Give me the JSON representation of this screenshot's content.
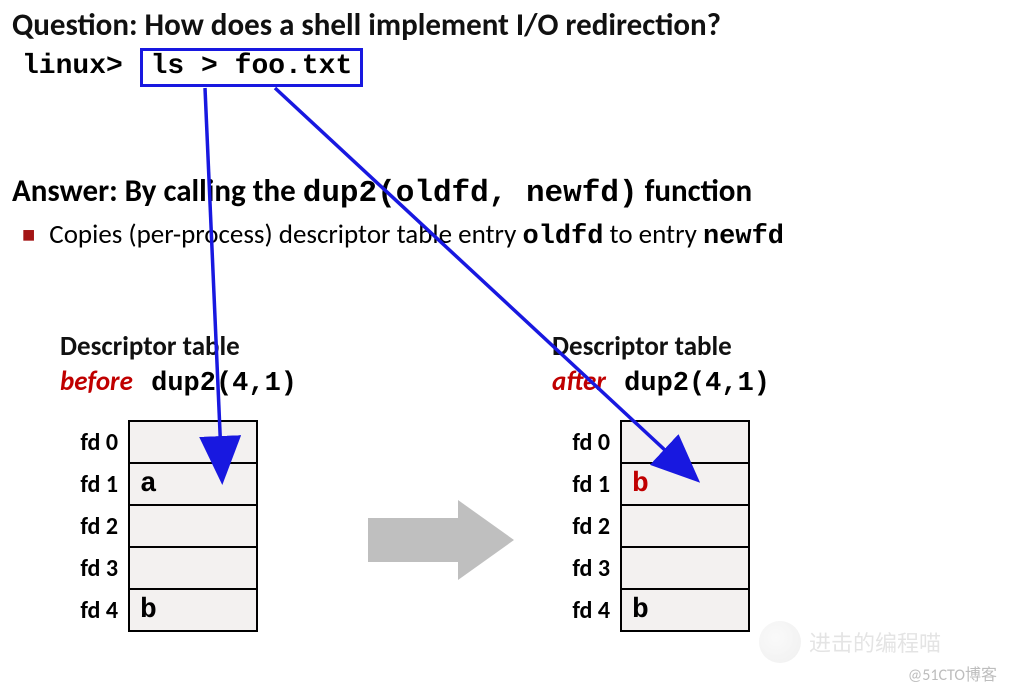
{
  "question": "Question: How does a shell implement I/O redirection?",
  "prompt": "linux> ",
  "command_boxed": "ls > foo.txt",
  "answer_prefix": "Answer: By calling the ",
  "answer_call": "dup2(oldfd, newfd)",
  "answer_suffix": " function",
  "bullet_pre": "Copies (per-process) descriptor table entry ",
  "bullet_old": "oldfd",
  "bullet_mid": " to entry ",
  "bullet_new": "newfd",
  "before": {
    "title": "Descriptor table",
    "word": "before",
    "call": "dup2(4,1)",
    "rows": [
      {
        "label": "fd 0",
        "value": ""
      },
      {
        "label": "fd 1",
        "value": "a"
      },
      {
        "label": "fd 2",
        "value": ""
      },
      {
        "label": "fd 3",
        "value": ""
      },
      {
        "label": "fd 4",
        "value": "b"
      }
    ]
  },
  "after": {
    "title": "Descriptor table",
    "word": "after",
    "call": "dup2(4,1)",
    "rows": [
      {
        "label": "fd 0",
        "value": ""
      },
      {
        "label": "fd 1",
        "value": "b",
        "highlight": true
      },
      {
        "label": "fd 2",
        "value": ""
      },
      {
        "label": "fd 3",
        "value": ""
      },
      {
        "label": "fd 4",
        "value": "b"
      }
    ]
  },
  "watermark_main": "进击的编程喵",
  "watermark_sub": "@51CTO博客"
}
